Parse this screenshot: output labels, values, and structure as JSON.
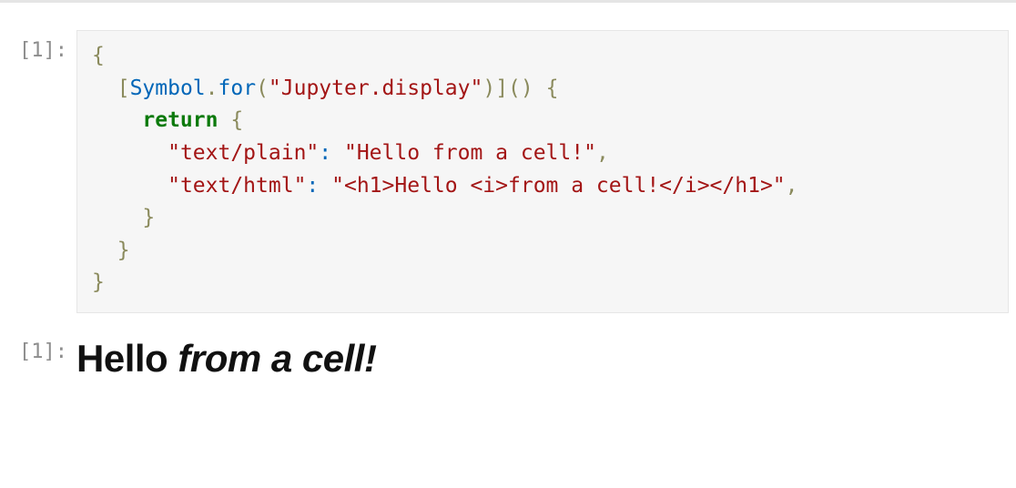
{
  "input": {
    "prompt": "[1]:",
    "code": {
      "t01": "{",
      "t02": "  ",
      "t03": "[",
      "t04": "Symbol",
      "t05": ".",
      "t06": "for",
      "t07": "(",
      "t08": "\"Jupyter.display\"",
      "t09": ")",
      "t10": "]",
      "t11": "()",
      "t12": " ",
      "t13": "{",
      "t14": "    ",
      "t15": "return",
      "t16": " ",
      "t17": "{",
      "t18": "      ",
      "t19": "\"text/plain\"",
      "t20": ":",
      "t21": " ",
      "t22": "\"Hello from a cell!\"",
      "t23": ",",
      "t24": "      ",
      "t25": "\"text/html\"",
      "t26": ":",
      "t27": " ",
      "t28": "\"<h1>Hello <i>from a cell!</i></h1>\"",
      "t29": ",",
      "t30": "    ",
      "t31": "}",
      "t32": "  ",
      "t33": "}",
      "t34": "}"
    }
  },
  "output": {
    "prompt": "[1]:",
    "heading_plain": "Hello ",
    "heading_italic": "from a cell!"
  }
}
